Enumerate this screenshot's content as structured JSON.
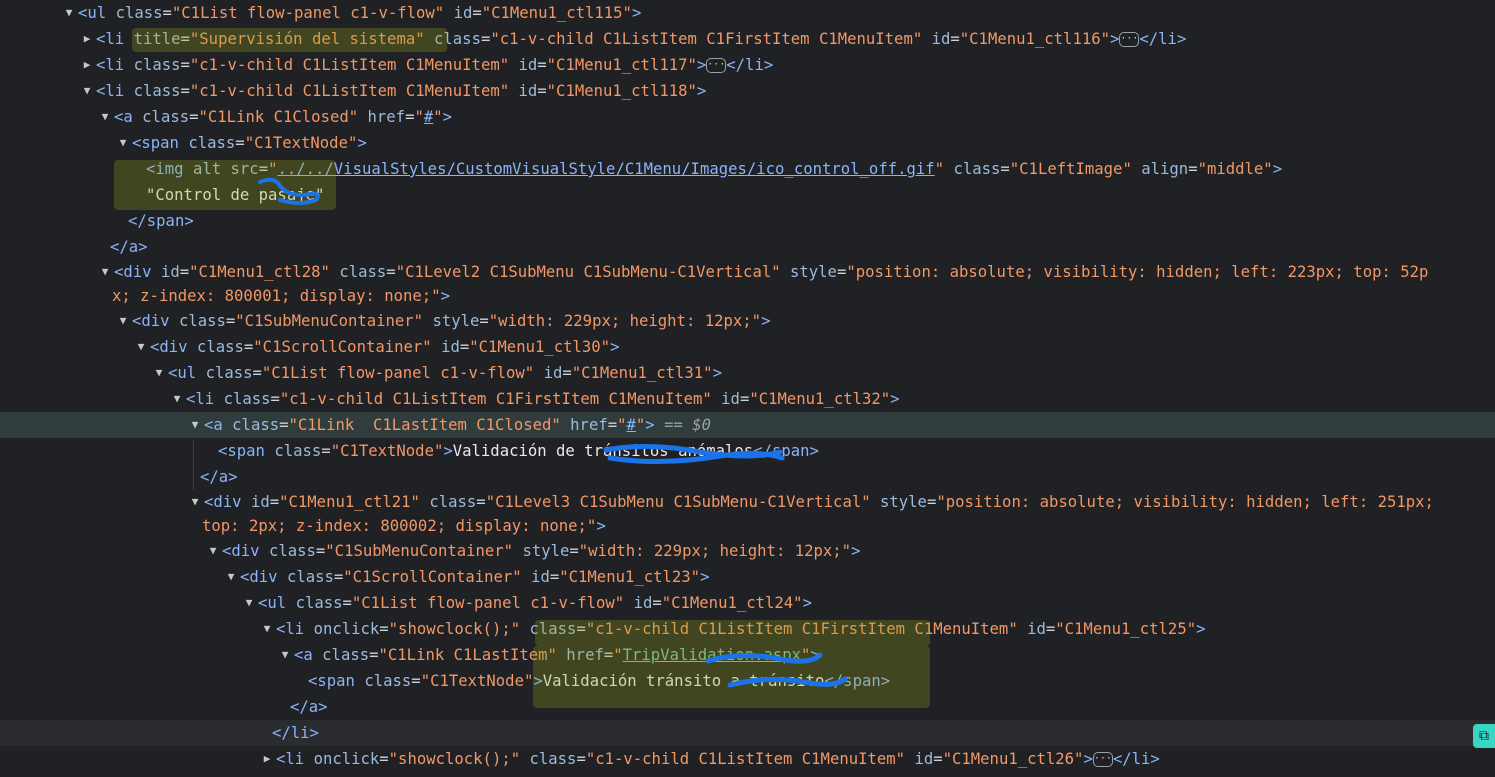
{
  "rows": [
    {
      "indent": 62,
      "arrow": "open",
      "html": "<span class='tg'>&lt;ul</span> <span class='at'>class</span>=<span class='av'>\"C1List flow-panel c1-v-flow\"</span> <span class='at'>id</span>=<span class='av'>\"C1Menu1_ctl115\"</span><span class='tg'>&gt;</span>"
    },
    {
      "indent": 80,
      "arrow": "closed",
      "html": "<span class='tg'>&lt;li</span> <span class='at'>title</span>=<span class='av'>\"Supervisión del sistema\"</span> <span class='at'>class</span>=<span class='av'>\"c1-v-child C1ListItem C1FirstItem C1MenuItem\"</span> <span class='at'>id</span>=<span class='av'>\"C1Menu1_ctl116\"</span><span class='tg'>&gt;</span><span class='ell'>···</span><span class='tg'>&lt;/li&gt;</span>"
    },
    {
      "indent": 80,
      "arrow": "closed",
      "html": "<span class='tg'>&lt;li</span> <span class='at'>class</span>=<span class='av'>\"c1-v-child C1ListItem C1MenuItem\"</span> <span class='at'>id</span>=<span class='av'>\"C1Menu1_ctl117\"</span><span class='tg'>&gt;</span><span class='ell'>···</span><span class='tg'>&lt;/li&gt;</span>"
    },
    {
      "indent": 80,
      "arrow": "open",
      "html": "<span class='tg'>&lt;li</span> <span class='at'>class</span>=<span class='av'>\"c1-v-child C1ListItem C1MenuItem\"</span> <span class='at'>id</span>=<span class='av'>\"C1Menu1_ctl118\"</span><span class='tg'>&gt;</span>"
    },
    {
      "indent": 98,
      "arrow": "open",
      "html": "<span class='tg'>&lt;a</span> <span class='at'>class</span>=<span class='av'>\"C1Link C1Closed\"</span> <span class='at'>href</span>=<span class='av'>\"<span class='lk'>#</span>\"</span><span class='tg'>&gt;</span>"
    },
    {
      "indent": 116,
      "arrow": "open",
      "html": "<span class='tg'>&lt;span</span> <span class='at'>class</span>=<span class='av'>\"C1TextNode\"</span><span class='tg'>&gt;</span>"
    },
    {
      "indent": 146,
      "arrow": "",
      "html": "<span class='tg'>&lt;img</span> <span class='at'>alt</span> <span class='at'>src</span>=<span class='av'>\"<span class='lk'>../../VisualStyles/CustomVisualStyle/C1Menu/Images/ico_control_off.gif</span>\"</span> <span class='at'>class</span>=<span class='av'>\"C1LeftImage\"</span> <span class='at'>align</span>=<span class='av'>\"middle\"</span><span class='tg'>&gt;</span>"
    },
    {
      "indent": 146,
      "arrow": "",
      "html": "<span class='tx'>\"Control de pasaje\"</span>"
    },
    {
      "indent": 128,
      "arrow": "",
      "html": "<span class='tg'>&lt;/span&gt;</span>"
    },
    {
      "indent": 110,
      "arrow": "",
      "html": "<span class='tg'>&lt;/a&gt;</span>"
    },
    {
      "indent": 98,
      "arrow": "open",
      "wrap": "first",
      "html": "<span class='tg'>&lt;div</span> <span class='at'>id</span>=<span class='av'>\"C1Menu1_ctl28\"</span> <span class='at'>class</span>=<span class='av'>\"C1Level2 C1SubMenu C1SubMenu-C1Vertical\"</span> <span class='at'>style</span>=<span class='av'>\"position: absolute; visibility: hidden; left: 223px; top: 52p</span>"
    },
    {
      "indent": 112,
      "arrow": "",
      "wrap": "second",
      "html": "<span class='av'>x; z-index: 800001; display: none;\"</span><span class='tg'>&gt;</span>"
    },
    {
      "indent": 116,
      "arrow": "open",
      "html": "<span class='tg'>&lt;div</span> <span class='at'>class</span>=<span class='av'>\"C1SubMenuContainer\"</span> <span class='at'>style</span>=<span class='av'>\"width: 229px; height: 12px;\"</span><span class='tg'>&gt;</span>"
    },
    {
      "indent": 134,
      "arrow": "open",
      "html": "<span class='tg'>&lt;div</span> <span class='at'>class</span>=<span class='av'>\"C1ScrollContainer\"</span> <span class='at'>id</span>=<span class='av'>\"C1Menu1_ctl30\"</span><span class='tg'>&gt;</span>"
    },
    {
      "indent": 152,
      "arrow": "open",
      "html": "<span class='tg'>&lt;ul</span> <span class='at'>class</span>=<span class='av'>\"C1List flow-panel c1-v-flow\"</span> <span class='at'>id</span>=<span class='av'>\"C1Menu1_ctl31\"</span><span class='tg'>&gt;</span>"
    },
    {
      "indent": 170,
      "arrow": "open",
      "html": "<span class='tg'>&lt;li</span> <span class='at'>class</span>=<span class='av'>\"c1-v-child C1ListItem C1FirstItem C1MenuItem\"</span> <span class='at'>id</span>=<span class='av'>\"C1Menu1_ctl32\"</span><span class='tg'>&gt;</span>"
    },
    {
      "indent": 188,
      "arrow": "open",
      "selected": true,
      "html": "<span class='tg'>&lt;a</span> <span class='at'>class</span>=<span class='av'>\"C1Link  C1LastItem C1Closed\"</span> <span class='at'>href</span>=<span class='av'>\"<span class='lk'>#</span>\"</span><span class='tg'>&gt;</span> <span class='dim'>== $0</span>"
    },
    {
      "indent": 218,
      "arrow": "",
      "html": "<span class='tg'>&lt;span</span> <span class='at'>class</span>=<span class='av'>\"C1TextNode\"</span><span class='tg'>&gt;</span><span class='tx'>Validación de tránsitos anómalos</span><span class='tg'>&lt;/span&gt;</span>"
    },
    {
      "indent": 200,
      "arrow": "",
      "html": "<span class='tg'>&lt;/a&gt;</span>"
    },
    {
      "indent": 188,
      "arrow": "open",
      "wrap": "first",
      "html": "<span class='tg'>&lt;div</span> <span class='at'>id</span>=<span class='av'>\"C1Menu1_ctl21\"</span> <span class='at'>class</span>=<span class='av'>\"C1Level3 C1SubMenu C1SubMenu-C1Vertical\"</span> <span class='at'>style</span>=<span class='av'>\"position: absolute; visibility: hidden; left: 251px;</span>"
    },
    {
      "indent": 202,
      "arrow": "",
      "wrap": "second",
      "html": "<span class='av'>top: 2px; z-index: 800002; display: none;\"</span><span class='tg'>&gt;</span>"
    },
    {
      "indent": 206,
      "arrow": "open",
      "html": "<span class='tg'>&lt;div</span> <span class='at'>class</span>=<span class='av'>\"C1SubMenuContainer\"</span> <span class='at'>style</span>=<span class='av'>\"width: 229px; height: 12px;\"</span><span class='tg'>&gt;</span>"
    },
    {
      "indent": 224,
      "arrow": "open",
      "html": "<span class='tg'>&lt;div</span> <span class='at'>class</span>=<span class='av'>\"C1ScrollContainer\"</span> <span class='at'>id</span>=<span class='av'>\"C1Menu1_ctl23\"</span><span class='tg'>&gt;</span>"
    },
    {
      "indent": 242,
      "arrow": "open",
      "html": "<span class='tg'>&lt;ul</span> <span class='at'>class</span>=<span class='av'>\"C1List flow-panel c1-v-flow\"</span> <span class='at'>id</span>=<span class='av'>\"C1Menu1_ctl24\"</span><span class='tg'>&gt;</span>"
    },
    {
      "indent": 260,
      "arrow": "open",
      "html": "<span class='tg'>&lt;li</span> <span class='at'>onclick</span>=<span class='av'>\"showclock();\"</span> <span class='at'>class</span>=<span class='av'>\"c1-v-child C1ListItem C1FirstItem C1MenuItem\"</span> <span class='at'>id</span>=<span class='av'>\"C1Menu1_ctl25\"</span><span class='tg'>&gt;</span>"
    },
    {
      "indent": 278,
      "arrow": "open",
      "html": "<span class='tg'>&lt;a</span> <span class='at'>class</span>=<span class='av'>\"C1Link C1LastItem\"</span> <span class='at'>href</span>=<span class='av'>\"<span class='lk2'>TripValidation.aspx</span>\"</span><span class='tg'>&gt;</span>"
    },
    {
      "indent": 308,
      "arrow": "",
      "html": "<span class='tg'>&lt;span</span> <span class='at'>class</span>=<span class='av'>\"C1TextNode\"</span><span class='tg'>&gt;</span><span class='tx'>Validación tránsito a tránsito</span><span class='tg'>&lt;/span&gt;</span>"
    },
    {
      "indent": 290,
      "arrow": "",
      "html": "<span class='tg'>&lt;/a&gt;</span>"
    },
    {
      "indent": 272,
      "arrow": "",
      "hover": true,
      "html": "<span class='tg'>&lt;/li&gt;</span>"
    },
    {
      "indent": 260,
      "arrow": "closed",
      "html": "<span class='tg'>&lt;li</span> <span class='at'>onclick</span>=<span class='av'>\"showclock();\"</span> <span class='at'>class</span>=<span class='av'>\"c1-v-child C1ListItem C1MenuItem\"</span> <span class='at'>id</span>=<span class='av'>\"C1Menu1_ctl26\"</span><span class='tg'>&gt;</span><span class='ell'>···</span><span class='tg'>&lt;/li&gt;</span>"
    }
  ],
  "copy_icon": "copy-icon",
  "colors": {
    "background": "#202124",
    "selected_row": "#303d3c",
    "tag": "#8ab4f8",
    "attribute_value": "#f29766",
    "highlight": "#96aa14",
    "scribble": "#1a73e8"
  }
}
